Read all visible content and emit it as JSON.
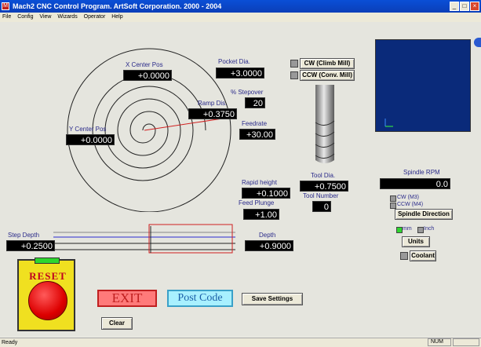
{
  "window": {
    "title": "Mach2 CNC Control Program. ArtSoft Corporation. 2000 - 2004",
    "app_icon_glyph": "M"
  },
  "menu": [
    "File",
    "Config",
    "View",
    "Wizards",
    "Operator",
    "Help"
  ],
  "fields": {
    "x_center": {
      "label": "X Center Pos",
      "value": "+0.0000"
    },
    "y_center": {
      "label": "Y Center Pos",
      "value": "+0.0000"
    },
    "pocket_dia": {
      "label": "Pocket Dia.",
      "value": "+3.0000"
    },
    "stepover": {
      "label": "% Stepover",
      "value": "20"
    },
    "ramp_dis": {
      "label": "Ramp Dis.",
      "value": "+0.3750"
    },
    "feedrate": {
      "label": "Feedrate",
      "value": "+30.00"
    },
    "rapid_height": {
      "label": "Rapid height",
      "value": "+0.1000"
    },
    "feed_plunge": {
      "label": "Feed Plunge",
      "value": "+1.00"
    },
    "tool_dia": {
      "label": "Tool Dia.",
      "value": "+0.7500"
    },
    "tool_number": {
      "label": "Tool Number",
      "value": "0"
    },
    "step_depth": {
      "label": "Step Depth",
      "value": "+0.2500"
    },
    "depth": {
      "label": "Depth",
      "value": "+0.9000"
    },
    "spindle_rpm": {
      "label": "Spindle RPM",
      "value": "0.0"
    }
  },
  "buttons": {
    "cw_climb": "CW (Climb Mill)",
    "ccw_conv": "CCW (Conv. Mill)",
    "spindle_direction": "Spindle Direction",
    "units": "Units",
    "coolant": "Coolant",
    "exit": "EXIT",
    "post_code": "Post Code",
    "save_settings": "Save Settings",
    "clear": "Clear",
    "reset": "RESET"
  },
  "options": {
    "cw_m3": "CW (M3)",
    "ccw_m4": "CCW (M4)",
    "mm": "mm",
    "inch": "Inch"
  },
  "status": {
    "text": "Ready",
    "num": "NUM"
  },
  "colors": {
    "title_blue": "#0b3fb8",
    "led_green": "#2ed62e",
    "dro_green": "#23e023",
    "exit_red": "#c02020",
    "preview_navy": "#0a2a7a"
  }
}
